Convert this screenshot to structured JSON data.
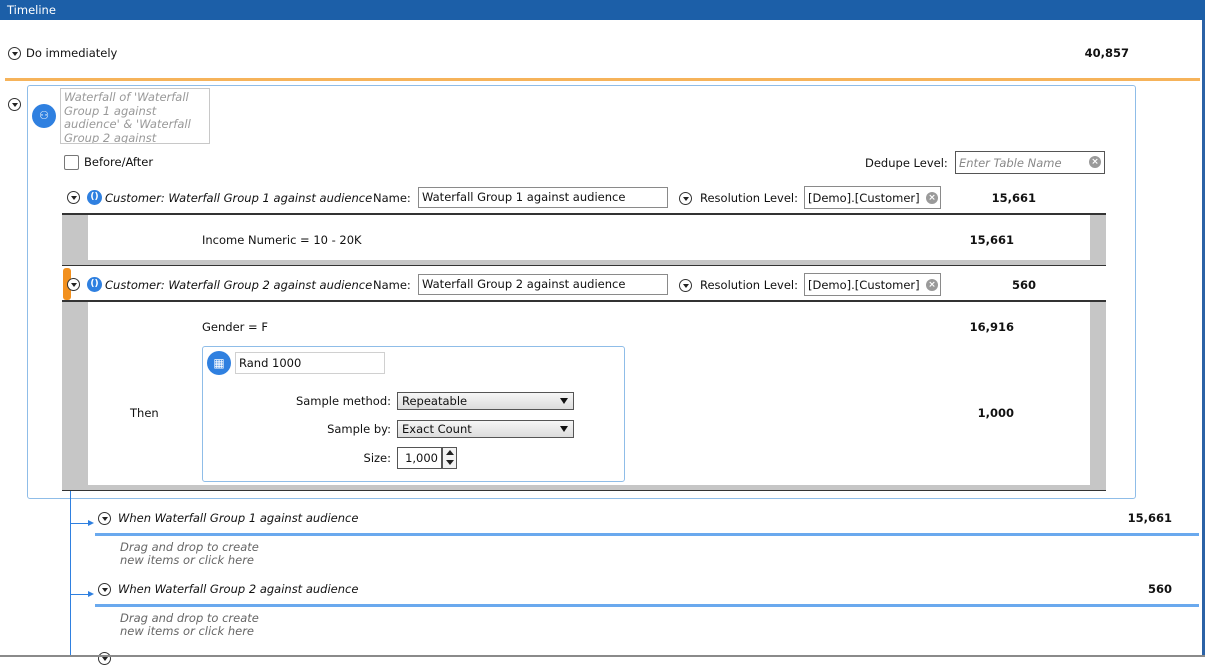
{
  "window": {
    "title": "Timeline"
  },
  "do_immediately": {
    "label": "Do immediately",
    "count": "40,857"
  },
  "waterfall": {
    "description_lines": [
      "Waterfall of 'Waterfall",
      "Group 1 against",
      "audience' & 'Waterfall",
      "Group 2 against"
    ],
    "before_after_label": "Before/After",
    "dedupe_label": "Dedupe Level:",
    "dedupe_placeholder": "Enter Table Name",
    "groups": [
      {
        "title": "Customer: Waterfall Group 1 against audience",
        "name_label": "Name:",
        "name_value": "Waterfall Group 1 against audience",
        "resolution_label": "Resolution Level:",
        "resolution_value": "[Demo].[Customer]",
        "count": "15,661",
        "rule": "Income Numeric = 10 - 20K",
        "rule_count": "15,661"
      },
      {
        "title": "Customer: Waterfall Group 2 against audience",
        "name_label": "Name:",
        "name_value": "Waterfall Group 2 against audience",
        "resolution_label": "Resolution Level:",
        "resolution_value": "[Demo].[Customer]",
        "count": "560",
        "rule": "Gender = F",
        "rule_count": "16,916",
        "then_label": "Then",
        "then_count": "1,000",
        "sample": {
          "name": "Rand 1000",
          "method_label": "Sample method:",
          "method_value": "Repeatable",
          "by_label": "Sample by:",
          "by_value": "Exact Count",
          "size_label": "Size:",
          "size_value": "1,000"
        }
      }
    ]
  },
  "branches": [
    {
      "label": "When Waterfall Group 1 against audience",
      "count": "15,661",
      "hint_lines": [
        "Drag and drop to create",
        "new items or click here"
      ]
    },
    {
      "label": "When Waterfall Group 2 against audience",
      "count": "560",
      "hint_lines": [
        "Drag and drop to create",
        "new items or click here"
      ]
    }
  ],
  "colors": {
    "title_bar": "#1c5fa8",
    "accent_orange": "#f6b35a",
    "accent_blue": "#6aa9ee",
    "icon_blue": "#2f80e0"
  }
}
